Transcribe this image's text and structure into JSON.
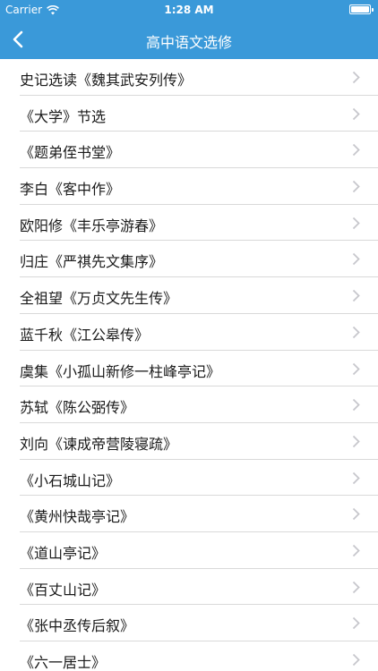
{
  "status_bar": {
    "carrier": "Carrier",
    "time": "1:28 AM",
    "wifi_icon": "wifi-icon",
    "battery_icon": "battery-icon"
  },
  "nav": {
    "title": "高中语文选修",
    "back_icon": "chevron-left-icon",
    "color": "#3a99d9"
  },
  "list": {
    "items": [
      {
        "label": "史记选读《魏其武安列传》"
      },
      {
        "label": "《大学》节选"
      },
      {
        "label": "《题弟侄书堂》"
      },
      {
        "label": "李白《客中作》"
      },
      {
        "label": "欧阳修《丰乐亭游春》"
      },
      {
        "label": "归庄《严祺先文集序》"
      },
      {
        "label": "全祖望《万贞文先生传》"
      },
      {
        "label": "蓝千秋《江公皋传》"
      },
      {
        "label": "虞集《小孤山新修一柱峰亭记》"
      },
      {
        "label": "苏轼《陈公弼传》"
      },
      {
        "label": "刘向《谏成帝营陵寝疏》"
      },
      {
        "label": "《小石城山记》"
      },
      {
        "label": "《黄州快哉亭记》"
      },
      {
        "label": "《道山亭记》"
      },
      {
        "label": "《百丈山记》"
      },
      {
        "label": "《张中丞传后叙》"
      },
      {
        "label": "《六一居士》"
      }
    ],
    "chevron_icon": "chevron-right-icon"
  }
}
